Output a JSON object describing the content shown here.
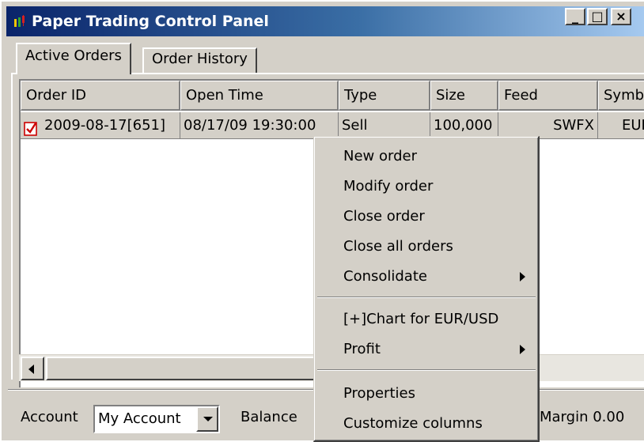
{
  "window": {
    "title": "Paper Trading Control Panel",
    "min_label": "_",
    "max_label": "□",
    "close_label": "×"
  },
  "tabs": [
    {
      "label": "Active Orders",
      "active": true
    },
    {
      "label": "Order History",
      "active": false
    }
  ],
  "table": {
    "columns": [
      "Order ID",
      "Open Time",
      "Type",
      "Size",
      "Feed",
      "Symbol"
    ],
    "rows": [
      {
        "order_id": "2009-08-17[651]",
        "open_time": "08/17/09 19:30:00",
        "type": "Sell",
        "size": "100,000",
        "feed": "SWFX",
        "symbol": "EUR/USD"
      }
    ]
  },
  "footer": {
    "account_label": "Account",
    "account_value": "My Account",
    "balance_label": "Balance",
    "margin_text": "Margin 0.00"
  },
  "context_menu": {
    "items": [
      {
        "label": "New order"
      },
      {
        "label": "Modify order"
      },
      {
        "label": "Close order"
      },
      {
        "label": "Close all orders"
      },
      {
        "label": "Consolidate",
        "submenu": true
      },
      {
        "label": "[+]Chart for EUR/USD"
      },
      {
        "label": "Profit",
        "submenu": true
      },
      {
        "label": "Properties"
      },
      {
        "label": "Customize columns"
      }
    ]
  },
  "colors": {
    "title_gradient_start": "#0a246a",
    "title_gradient_end": "#a6caf0",
    "face": "#d4d0c8",
    "order_icon_accent": "#cc0000"
  }
}
